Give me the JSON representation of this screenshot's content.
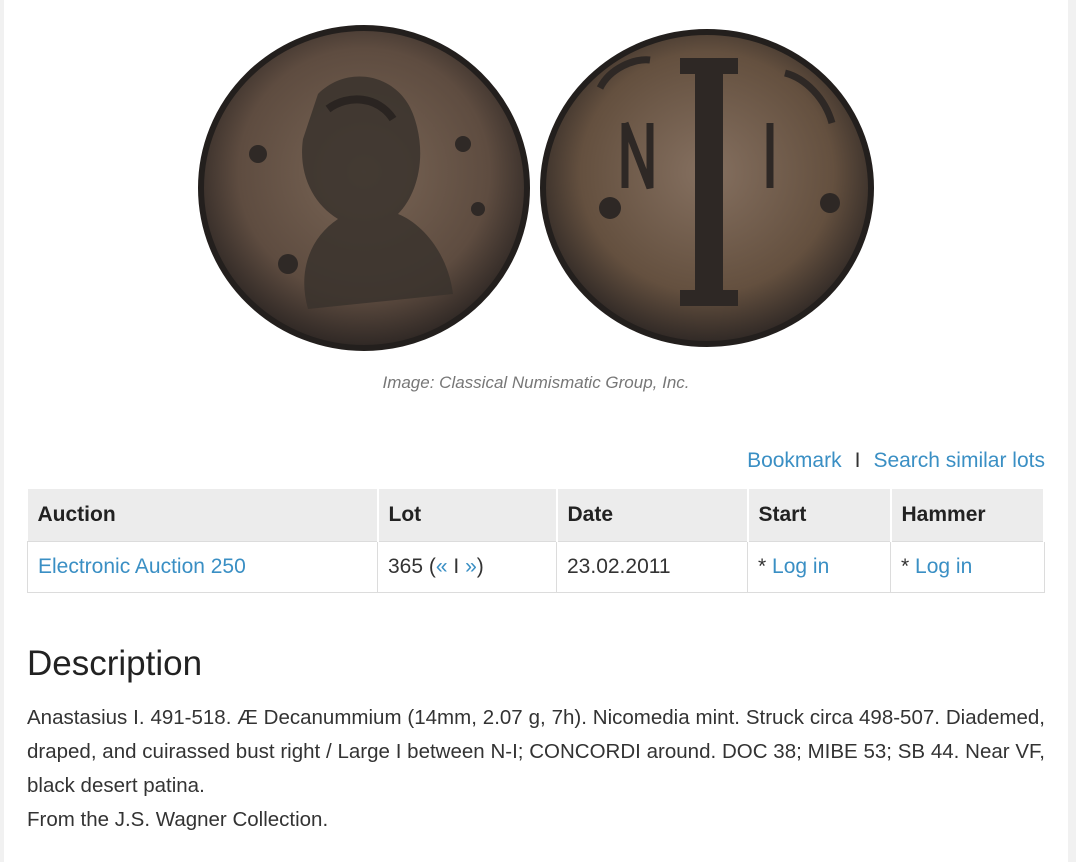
{
  "image": {
    "caption": "Image: Classical Numismatic Group, Inc.",
    "obverse_alt": "coin-obverse",
    "reverse_alt": "coin-reverse"
  },
  "actions": {
    "bookmark": "Bookmark",
    "separator": "I",
    "search_similar": "Search similar lots"
  },
  "table": {
    "headers": {
      "auction": "Auction",
      "lot": "Lot",
      "date": "Date",
      "start": "Start",
      "hammer": "Hammer"
    },
    "row": {
      "auction": "Electronic Auction 250",
      "lot_number": "365",
      "lot_paren_open": "(",
      "prev": "«",
      "lot_sep": "I",
      "next": "»",
      "lot_paren_close": ")",
      "date": "23.02.2011",
      "start_prefix": "*",
      "start_link": "Log in",
      "hammer_prefix": "*",
      "hammer_link": "Log in"
    }
  },
  "description": {
    "title": "Description",
    "text": "Anastasius I. 491-518. Æ Decanummium (14mm, 2.07 g, 7h). Nicomedia mint. Struck circa 498-507. Diademed, draped, and cuirassed bust right / Large I between N-I; CONCORDI around. DOC 38; MIBE 53; SB 44. Near VF, black desert patina.",
    "provenance": "From the J.S. Wagner Collection."
  },
  "colors": {
    "link": "#3a8fc4",
    "header_bg": "#ececec",
    "coin_patina": "#6b5848",
    "coin_dark": "#2b2624"
  }
}
